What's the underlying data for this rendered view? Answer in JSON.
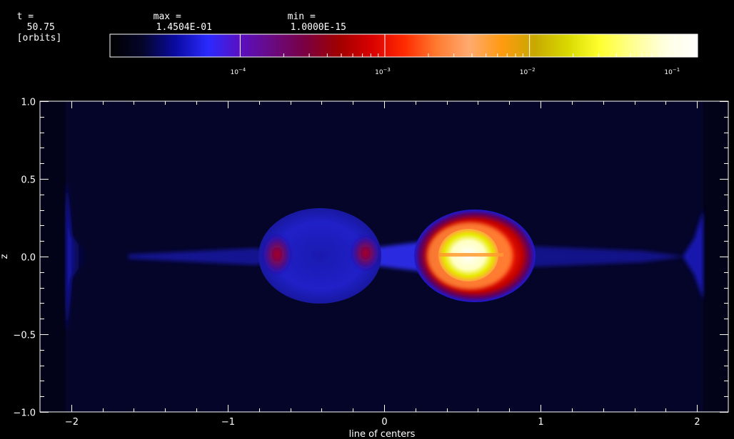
{
  "header": {
    "time_label": "t =",
    "time_value": "50.75",
    "time_unit": "[orbits]",
    "max_label": "max =",
    "max_value": "1.4504E-01",
    "min_label": "min =",
    "min_value": "1.0000E-15"
  },
  "colorbar": {
    "stops": [
      "#000000",
      "#05052a",
      "#0a0aa0",
      "#2a2aff",
      "#5a10c0",
      "#6a0a80",
      "#7a0040",
      "#a00000",
      "#d80000",
      "#ff2a00",
      "#ff7a30",
      "#ffaa70",
      "#ff9a10",
      "#c8a800",
      "#d8d800",
      "#ffff30",
      "#ffff90",
      "#ffffe0",
      "#ffffff"
    ],
    "tick_labels": [
      {
        "base": "10",
        "exp": "−4"
      },
      {
        "base": "10",
        "exp": "−3"
      },
      {
        "base": "10",
        "exp": "−2"
      },
      {
        "base": "10",
        "exp": "−1"
      }
    ]
  },
  "chart_data": {
    "type": "heatmap",
    "title": "",
    "xlabel": "line of centers",
    "ylabel": "z",
    "xlim": [
      -2.2,
      2.2
    ],
    "ylim": [
      -1.0,
      1.0
    ],
    "x_ticks": [
      -2,
      -1,
      0,
      1,
      2
    ],
    "x_tick_labels": [
      "−2",
      "−1",
      "0",
      "1",
      "2"
    ],
    "y_ticks": [
      -1.0,
      -0.5,
      0.0,
      0.5,
      1.0
    ],
    "y_tick_labels": [
      "−1.0",
      "−0.5",
      "0.0",
      "0.5",
      "1.0"
    ],
    "x_minor_step": 0.2,
    "y_minor_step": 0.1,
    "colorbar_scale": "log",
    "colorbar_decade_ticks": [
      0.0001,
      0.001,
      0.01,
      0.1
    ],
    "data_max": 0.14504,
    "data_min": 1e-15,
    "features": [
      {
        "name": "left-star",
        "cx": -0.42,
        "cz": 0.0,
        "rx": 0.44,
        "rz": 0.31,
        "color": "blue"
      },
      {
        "name": "right-star",
        "cx": 0.6,
        "cz": 0.0,
        "rx": 0.47,
        "rz": 0.3,
        "color": "red-yellow-white"
      },
      {
        "name": "midplane-stream",
        "x_from": -1.8,
        "x_to": 1.8,
        "z_halfwidth": 0.04,
        "color": "blue"
      },
      {
        "name": "left-edge-outflow",
        "x": -2.02,
        "z_extent": 0.45,
        "color": "blue"
      },
      {
        "name": "right-edge-outflow",
        "x": 2.0,
        "z_extent": 0.25,
        "color": "blue"
      }
    ]
  }
}
